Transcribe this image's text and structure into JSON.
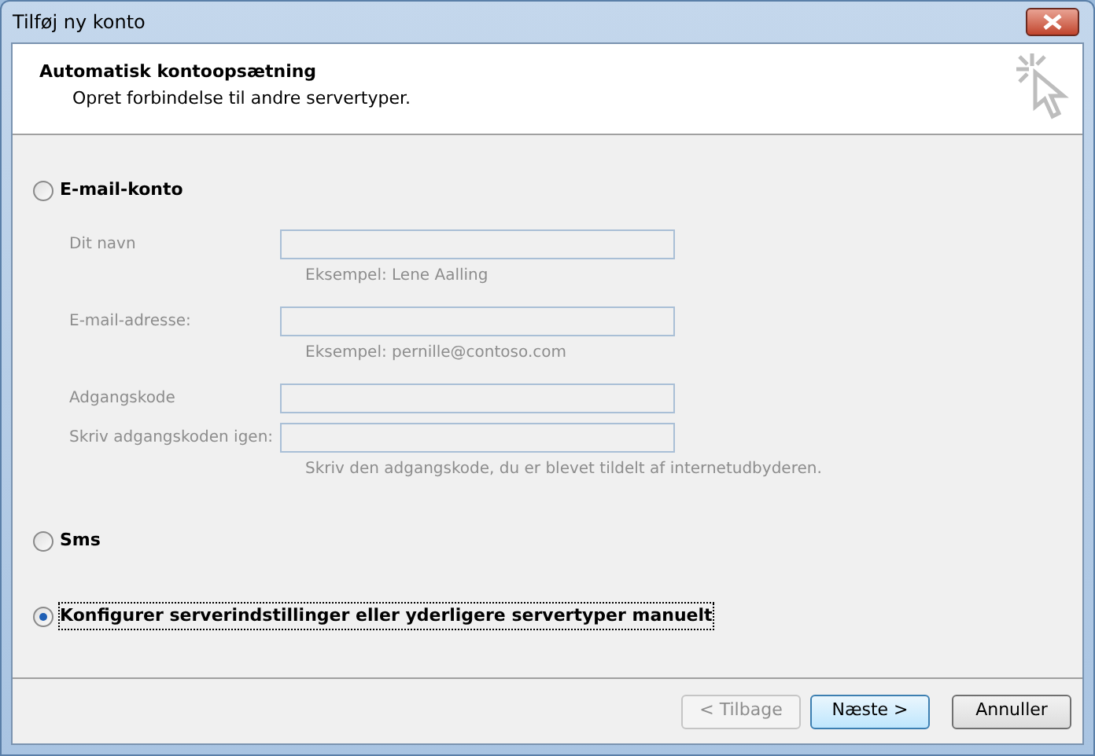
{
  "window": {
    "title": "Tilføj ny konto"
  },
  "header": {
    "title": "Automatisk kontoopsætning",
    "subtitle": "Opret forbindelse til andre servertyper."
  },
  "options": [
    {
      "label": "E-mail-konto",
      "selected": false,
      "fields": [
        {
          "label": "Dit navn",
          "hint": "Eksempel: Lene Aalling",
          "disabled": true
        },
        {
          "label": "E-mail-adresse:",
          "hint": "Eksempel: pernille@contoso.com",
          "disabled": true
        },
        {
          "label": "Adgangskode",
          "disabled": true
        },
        {
          "label": "Skriv adgangskoden igen:",
          "hint": "Skriv den adgangskode, du er blevet tildelt af internetudbyderen.",
          "disabled": true
        }
      ]
    },
    {
      "label": "Sms",
      "selected": false
    },
    {
      "label": "Konfigurer serverindstillinger eller yderligere servertyper manuelt",
      "selected": true
    }
  ],
  "buttons": [
    {
      "label": "< Tilbage",
      "disabled": true,
      "default": false
    },
    {
      "label": "Næste >",
      "disabled": false,
      "default": true
    },
    {
      "label": "Annuller",
      "disabled": false,
      "default": false
    }
  ]
}
